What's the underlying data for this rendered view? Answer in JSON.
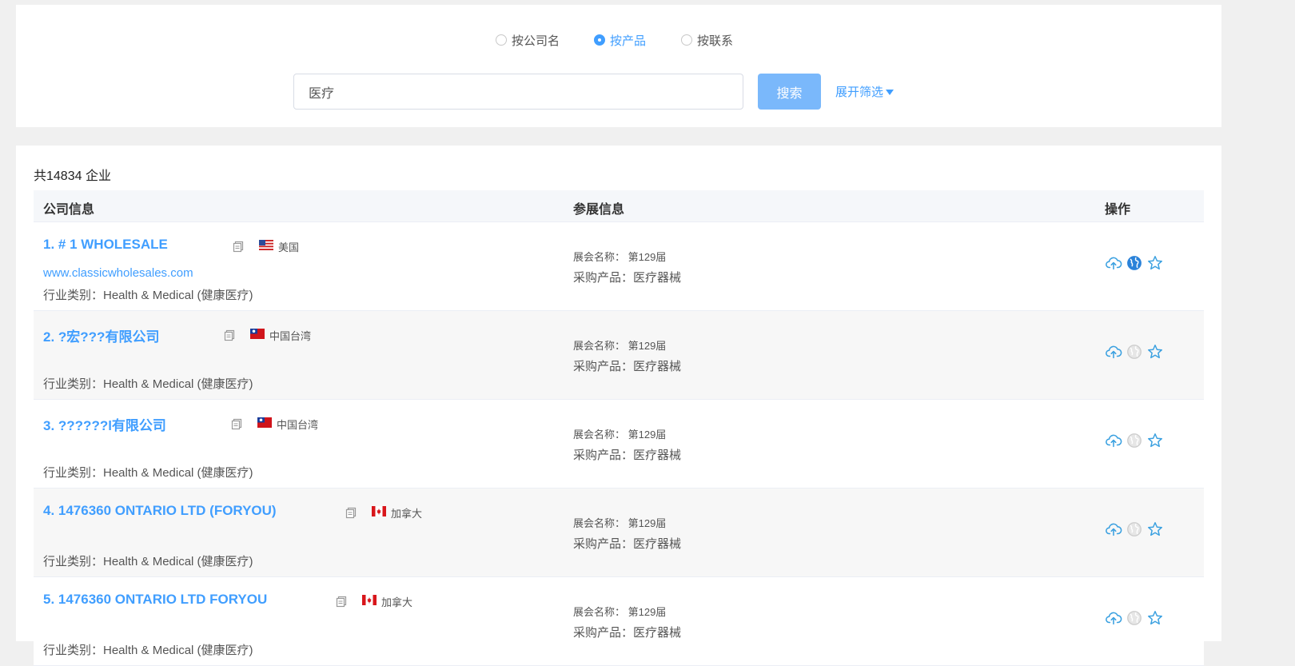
{
  "search": {
    "modes": [
      {
        "label": "按公司名",
        "checked": false
      },
      {
        "label": "按产品",
        "checked": true
      },
      {
        "label": "按联系",
        "checked": false
      }
    ],
    "query": "医疗",
    "search_label": "搜索",
    "filter_label": "展开筛选"
  },
  "results": {
    "total_label": "共14834 企业",
    "columns": {
      "company": "公司信息",
      "expo": "参展信息",
      "ops": "操作"
    },
    "rows": [
      {
        "name": "1. # 1 WHOLESALE",
        "flag": "us",
        "country": "美国",
        "website": "www.classicwholesales.com",
        "industry": "行业类别：Health & Medical (健康医疗)",
        "expo": "展会名称： 第129届",
        "purchase": "采购产品：医疗器械",
        "web_active": true
      },
      {
        "name": "2. ?宏???有限公司",
        "flag": "tw",
        "country": "中国台湾",
        "website": "",
        "industry": "行业类别：Health & Medical (健康医疗)",
        "expo": "展会名称： 第129届",
        "purchase": "采购产品：医疗器械",
        "web_active": false
      },
      {
        "name": "3. ??????l有限公司",
        "flag": "tw",
        "country": "中国台湾",
        "website": "",
        "industry": "行业类别：Health & Medical (健康医疗)",
        "expo": "展会名称： 第129届",
        "purchase": "采购产品：医疗器械",
        "web_active": false
      },
      {
        "name": "4. 1476360 ONTARIO LTD (FORYOU)",
        "flag": "ca",
        "country": "加拿大",
        "website": "",
        "industry": "行业类别：Health & Medical (健康医疗)",
        "expo": "展会名称： 第129届",
        "purchase": "采购产品：医疗器械",
        "web_active": false
      },
      {
        "name": "5. 1476360 ONTARIO LTD FORYOU",
        "flag": "ca",
        "country": "加拿大",
        "website": "",
        "industry": "行业类别：Health & Medical (健康医疗)",
        "expo": "展会名称： 第129届",
        "purchase": "采购产品：医疗器械",
        "web_active": false
      }
    ]
  },
  "icons": {
    "copy": "copy-icon",
    "upload": "cloud-upload-icon",
    "website": "globe-icon",
    "favorite": "star-icon"
  },
  "colors": {
    "accent": "#409eff",
    "button": "#7ab8fb",
    "ops_icon": "#3aa0e0",
    "inactive_globe": "#cccccc"
  }
}
